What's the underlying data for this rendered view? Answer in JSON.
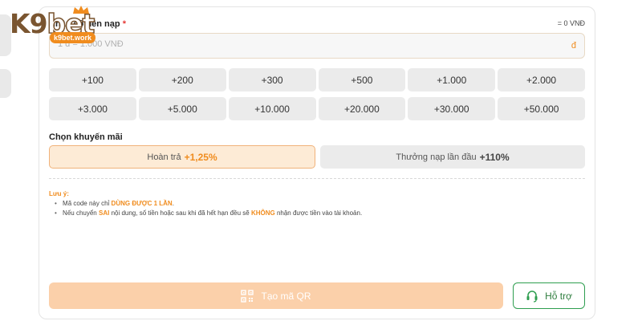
{
  "logo": {
    "text_main": "K9",
    "text_accent": "bet",
    "badge": "k9bet.work"
  },
  "amount": {
    "label": "Nhập số tiền nạp",
    "required_mark": "*",
    "equivalent": "= 0 VNĐ",
    "placeholder": "1 đ = 1.000 VNĐ",
    "value": "",
    "currency": "đ"
  },
  "quick_amounts": [
    "+100",
    "+200",
    "+300",
    "+500",
    "+1.000",
    "+2.000",
    "+3.000",
    "+5.000",
    "+10.000",
    "+20.000",
    "+30.000",
    "+50.000"
  ],
  "promotion": {
    "title": "Chọn khuyến mãi",
    "options": [
      {
        "label": "Hoàn trả",
        "percent": "+1,25%",
        "selected": true
      },
      {
        "label": "Thưởng nạp lần đầu",
        "percent": "+110%",
        "selected": false
      }
    ]
  },
  "notes": {
    "title": "Lưu ý:",
    "line1_prefix": "Mã code này chỉ",
    "line1_highlight": "DÙNG ĐƯỢC 1 LẦN",
    "line1_suffix": ".",
    "line2_prefix": "Nếu chuyển",
    "line2_highlight1": "SAI",
    "line2_middle": "nội dung, số tiền hoặc sau khi đã hết hạn đều sẽ",
    "line2_highlight2": "KHÔNG",
    "line2_suffix": "nhận được tiền vào tài khoản."
  },
  "actions": {
    "qr_label": "Tạo mã QR",
    "support_label": "Hỗ trợ"
  },
  "colors": {
    "accent": "#f08c1e",
    "support_green": "#2e9e4f",
    "qr_disabled_bg": "#fbd0aa"
  },
  "icons": {
    "qr": "qr-code-icon",
    "support": "headset-icon",
    "crown": "crown-icon"
  }
}
